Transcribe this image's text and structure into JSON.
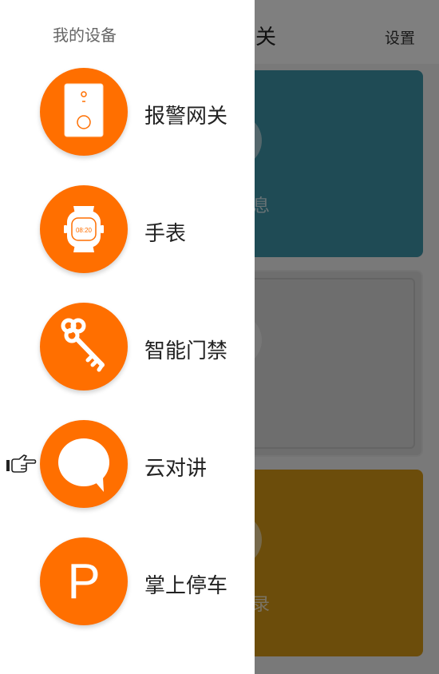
{
  "background": {
    "title": "关",
    "settings": "设置",
    "cards": [
      {
        "text": "息",
        "color": "#3f96aa"
      },
      {
        "text": "",
        "color": "#dcdcdc"
      },
      {
        "text": "录",
        "color": "#d89b17"
      }
    ]
  },
  "drawer": {
    "title": "我的设备",
    "items": [
      {
        "label": "报警网关",
        "icon": "alarm-gateway-icon"
      },
      {
        "label": "手表",
        "icon": "watch-icon",
        "watch_time": "08:20"
      },
      {
        "label": "智能门禁",
        "icon": "key-icon"
      },
      {
        "label": "云对讲",
        "icon": "chat-bubble-icon"
      },
      {
        "label": "掌上停车",
        "icon": "parking-icon",
        "glyph": "P"
      }
    ]
  },
  "colors": {
    "accent": "#ff6f00",
    "drawer_bg": "#ffffff"
  }
}
